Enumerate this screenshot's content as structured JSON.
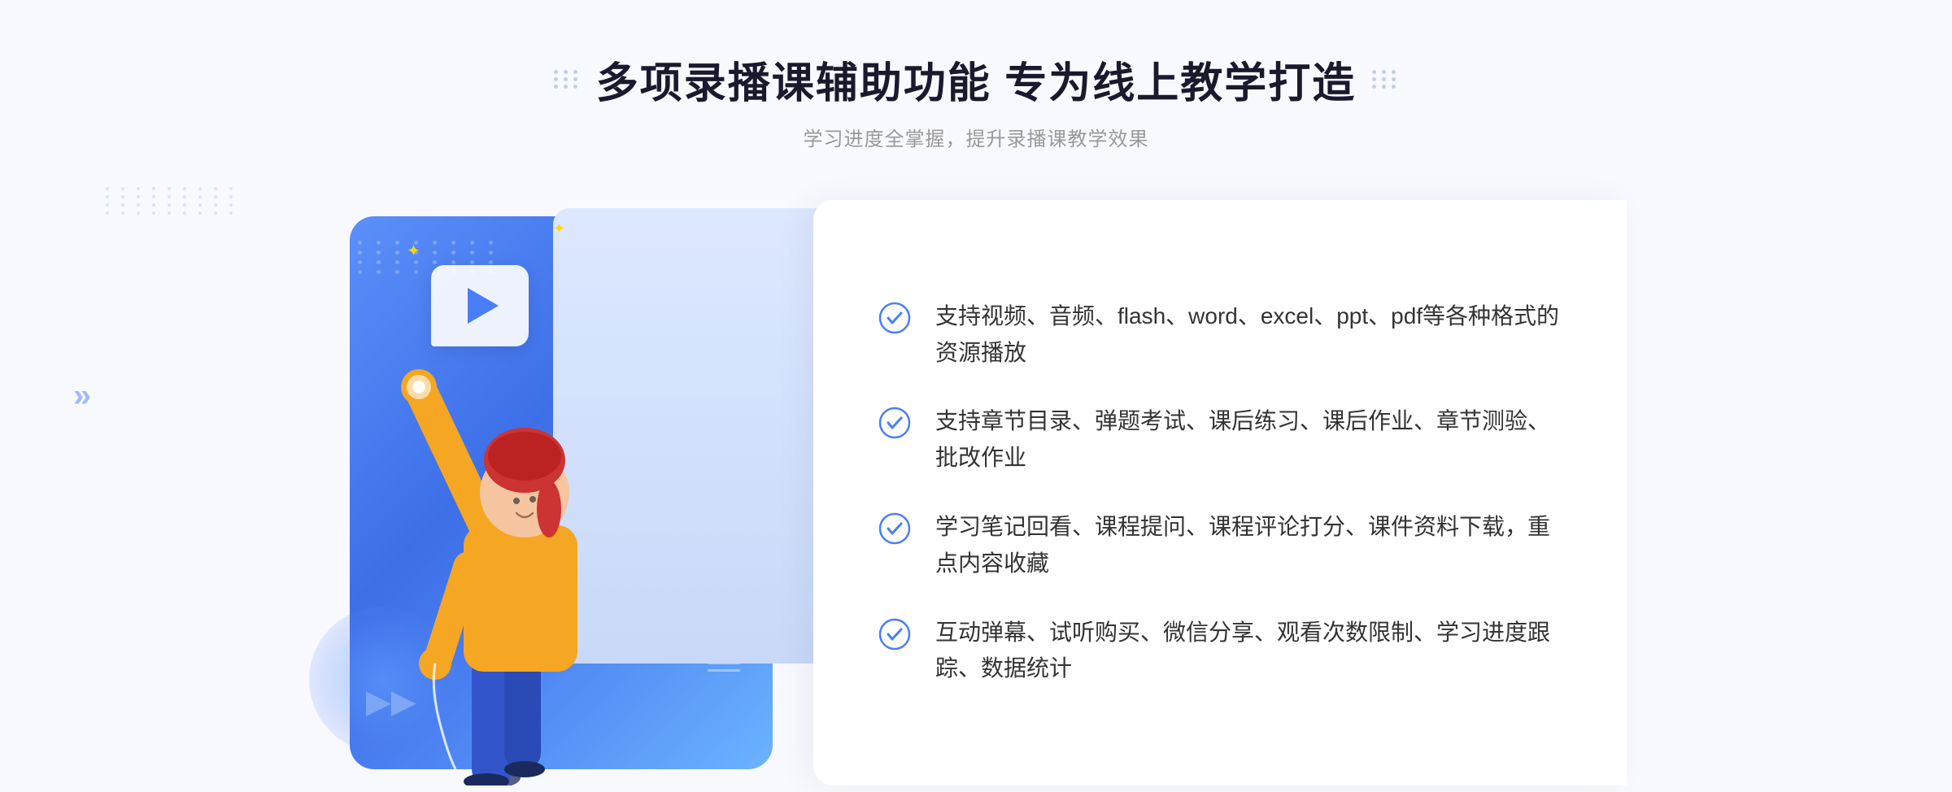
{
  "header": {
    "title": "多项录播课辅助功能 专为线上教学打造",
    "subtitle": "学习进度全掌握，提升录播课教学效果"
  },
  "features": [
    {
      "id": 1,
      "text": "支持视频、音频、flash、word、excel、ppt、pdf等各种格式的资源播放"
    },
    {
      "id": 2,
      "text": "支持章节目录、弹题考试、课后练习、课后作业、章节测验、批改作业"
    },
    {
      "id": 3,
      "text": "学习笔记回看、课程提问、课程评论打分、课件资料下载，重点内容收藏"
    },
    {
      "id": 4,
      "text": "互动弹幕、试听购买、微信分享、观看次数限制、学习进度跟踪、数据统计"
    }
  ],
  "decorators": {
    "left_arrows": "»",
    "sparkle": "✦"
  }
}
